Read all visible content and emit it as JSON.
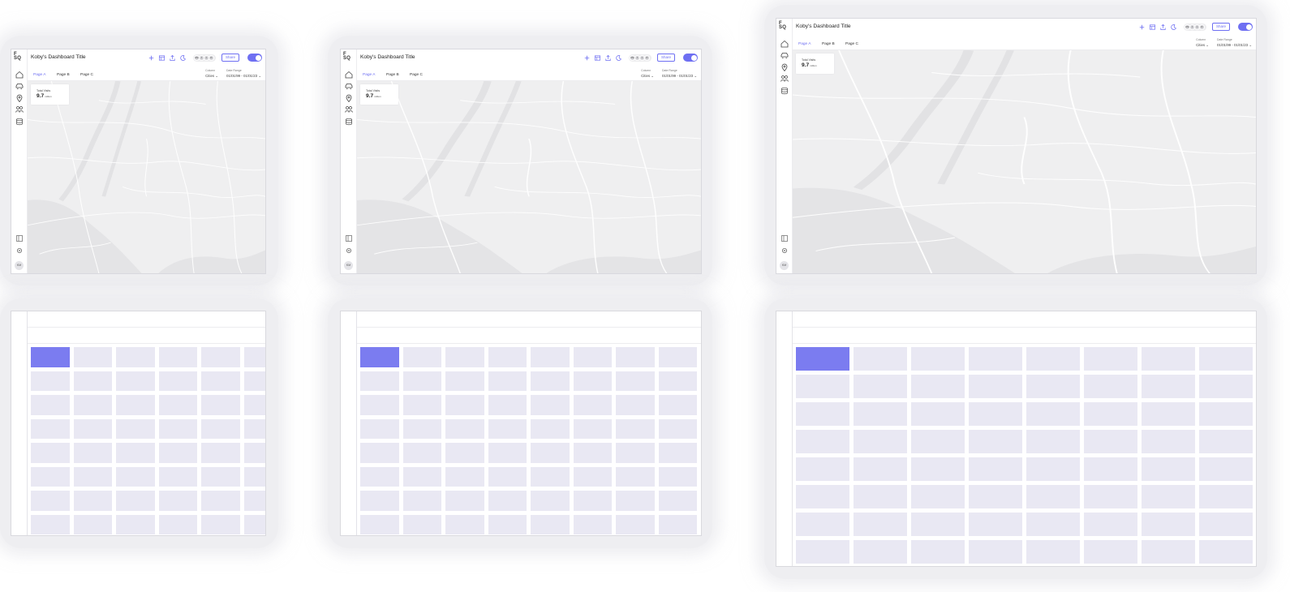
{
  "dashboard": {
    "logo": [
      "F",
      "SQ"
    ],
    "title": "Koby's Dashboard Title",
    "tabs": [
      {
        "label": "Page A",
        "active": true
      },
      {
        "label": "Page B",
        "active": false
      },
      {
        "label": "Page C",
        "active": false
      }
    ],
    "column_filter": {
      "label": "Column",
      "value": "Cities ⌄"
    },
    "date_filter": {
      "label": "Date Range",
      "value": "01/01/99 - 01/01/23 ⌄"
    },
    "share_label": "Share",
    "collaborators": [
      "KM",
      "J",
      "L",
      "D"
    ],
    "user_initials": "KM",
    "kpi": {
      "label": "Total Visits",
      "value": "9.7",
      "unit": "million"
    },
    "toggle_on": true,
    "sidebar_icons": [
      "home-icon",
      "car-icon",
      "location-pin-icon",
      "people-icon",
      "database-icon"
    ],
    "sidebar_bottom_icons": [
      "panel-icon",
      "settings-icon"
    ],
    "toolbar_icons": [
      "plus-icon",
      "layout-icon",
      "upload-icon",
      "moon-icon"
    ]
  },
  "colors": {
    "accent": "#6e6ff2",
    "cell": "#e9e8f3",
    "cell_selected": "#7b7cf0",
    "map_bg": "#efeff0"
  },
  "grid": {
    "rows": 8,
    "selected_cell": {
      "row": 1,
      "col": 1
    }
  }
}
